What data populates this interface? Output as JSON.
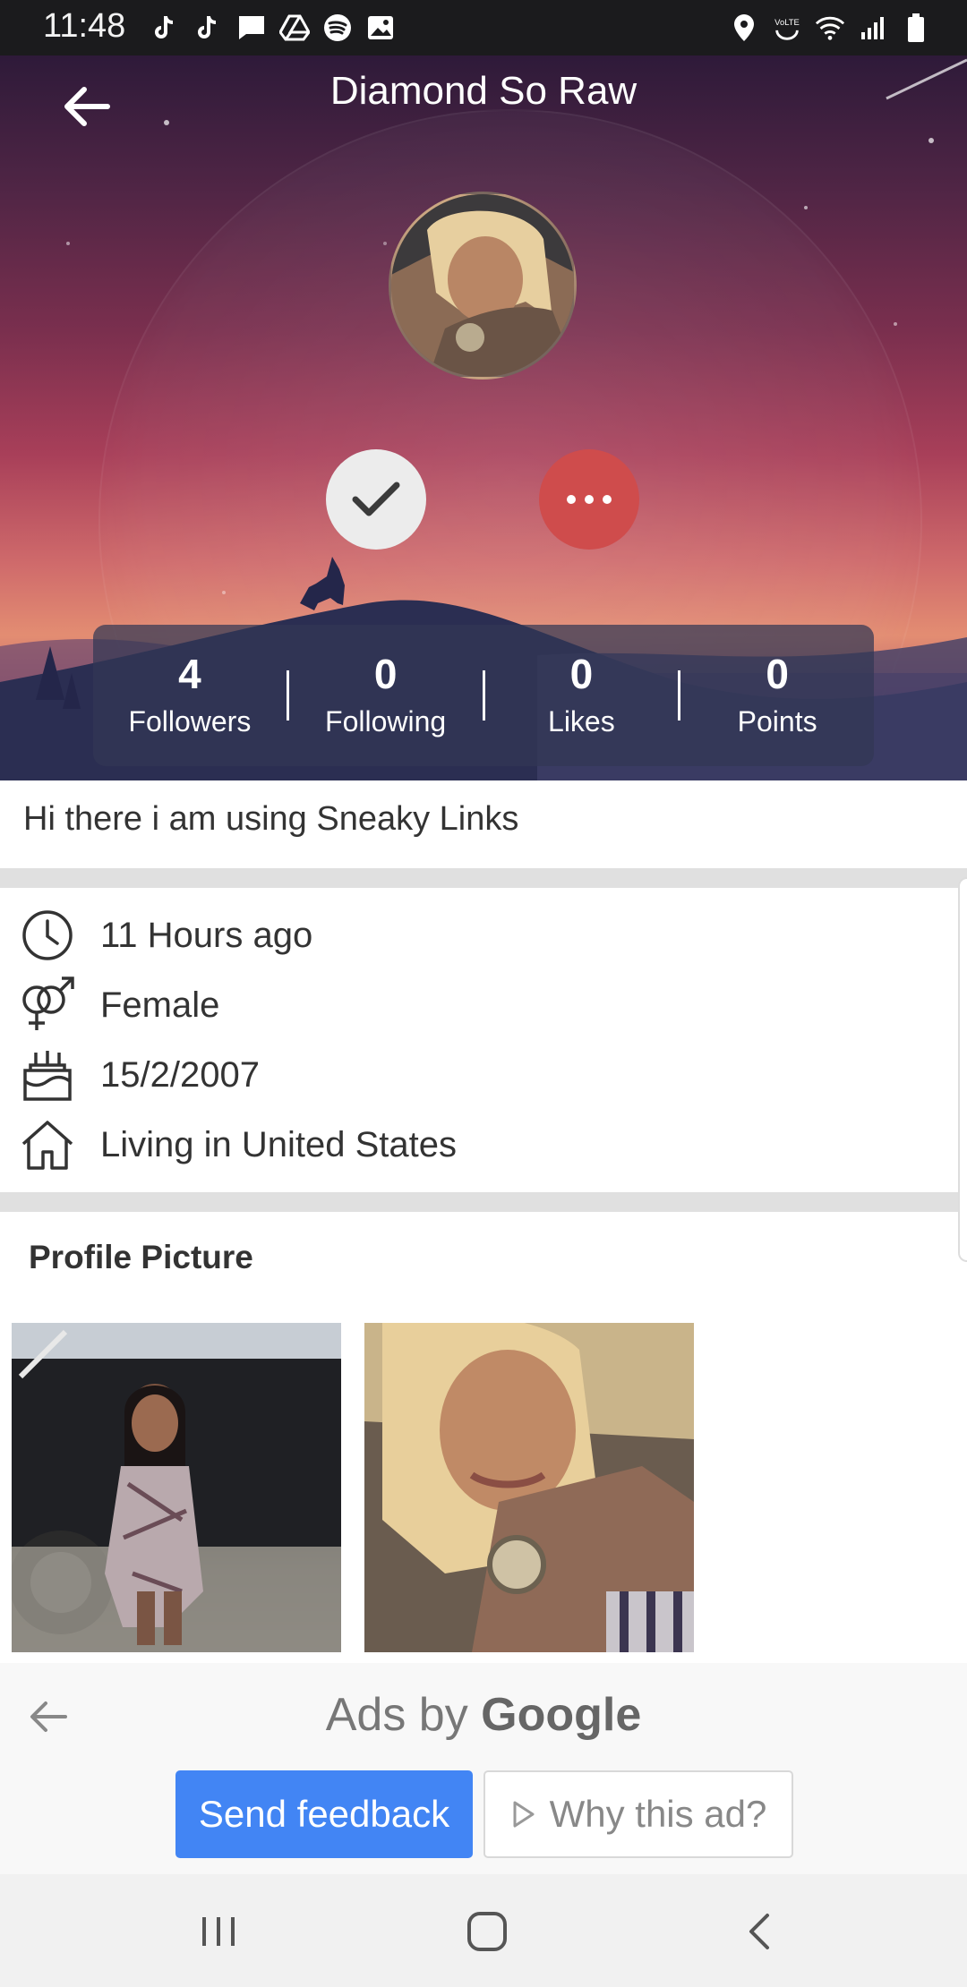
{
  "status_bar": {
    "time": "11:48",
    "left_icons": [
      "tiktok-icon",
      "tiktok-icon",
      "message-icon",
      "drive-icon",
      "spotify-icon",
      "gallery-icon"
    ],
    "right_icons": [
      "location-icon",
      "volte-icon",
      "wifi-icon",
      "signal-icon",
      "battery-icon"
    ],
    "volte_label": "VoLTE"
  },
  "header": {
    "title": "Diamond So Raw",
    "back_icon": "arrow-left-icon"
  },
  "actions": {
    "follow_icon": "check-icon",
    "more_icon": "more-horizontal-icon"
  },
  "stats": [
    {
      "value": "4",
      "label": "Followers"
    },
    {
      "value": "0",
      "label": "Following"
    },
    {
      "value": "0",
      "label": "Likes"
    },
    {
      "value": "0",
      "label": "Points"
    }
  ],
  "bio": "Hi there i am using Sneaky Links",
  "info": [
    {
      "icon": "clock-icon",
      "text": "11 Hours ago"
    },
    {
      "icon": "gender-icon",
      "text": "Female"
    },
    {
      "icon": "birthday-cake-icon",
      "text": "15/2/2007"
    },
    {
      "icon": "home-icon",
      "text": "Living in United States"
    }
  ],
  "profile_pictures": {
    "title": "Profile Picture",
    "count": 2
  },
  "ad": {
    "title_prefix": "Ads by ",
    "title_brand": "Google",
    "send_feedback": "Send feedback",
    "why_this_ad": "Why this ad?",
    "accent": "#4285f4"
  },
  "nav": {
    "recents_icon": "recents-icon",
    "home_icon": "home-circle-icon",
    "back_icon": "chevron-left-icon"
  }
}
